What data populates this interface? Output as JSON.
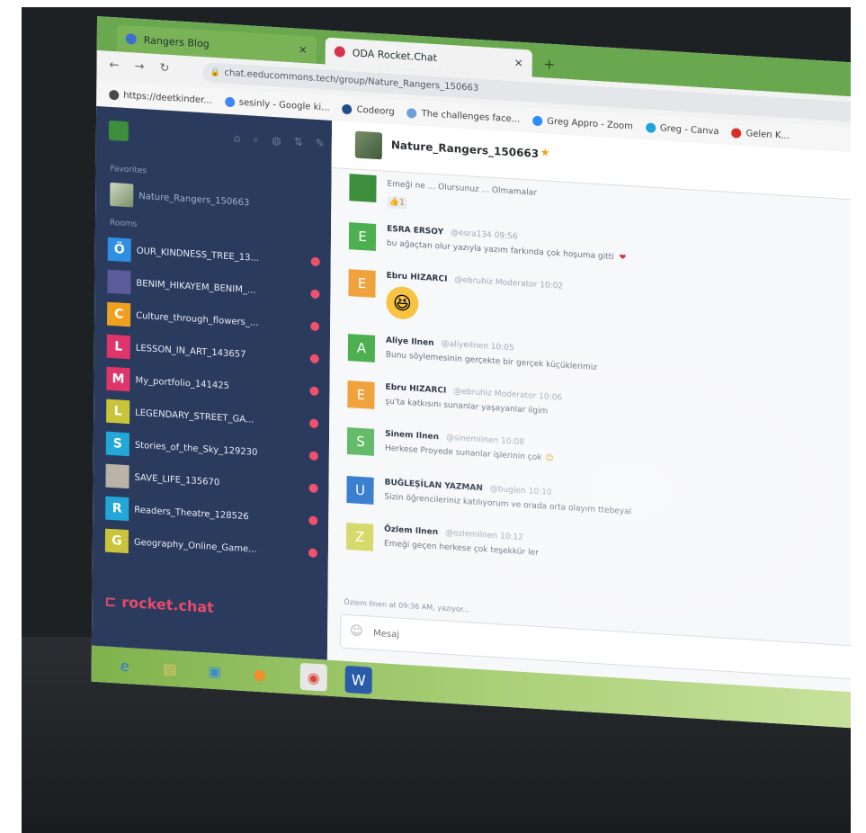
{
  "browser": {
    "tabs": [
      {
        "label": "Rangers Blog",
        "favicon_color": "#3b6fd4",
        "active": false
      },
      {
        "label": "ODA Rocket.Chat",
        "favicon_color": "#d8334a",
        "active": true
      }
    ],
    "new_tab": "+",
    "nav": {
      "back": "←",
      "forward": "→",
      "reload": "↻"
    },
    "url": "chat.eeducommons.tech/group/Nature_Rangers_150663",
    "bookmarks": [
      {
        "label": "https://deetkinder...",
        "icon_color": "#4a4a4a"
      },
      {
        "label": "sesinly - Google ki...",
        "icon_color": "#4285f4"
      },
      {
        "label": "Codeorg",
        "icon_color": "#1f4e8c"
      },
      {
        "label": "The challenges face...",
        "icon_color": "#6aa0d8"
      },
      {
        "label": "Greg Appro - Zoom",
        "icon_color": "#2d8cff"
      },
      {
        "label": "Greg - Canva",
        "icon_color": "#1fa3d9"
      },
      {
        "label": "Gelen K...",
        "icon_color": "#d93025"
      }
    ]
  },
  "sidebar": {
    "favorites_title": "Favorites",
    "favorite_room": "Nature_Rangers_150663",
    "rooms_title": "Rooms",
    "rooms": [
      {
        "initial": "Ö",
        "name": "OUR_KINDNESS_TREE_13...",
        "color": "#2f8fe0"
      },
      {
        "initial": "",
        "name": "BENIM_HIKAYEM_BENIM_...",
        "color": "#5b5b9a"
      },
      {
        "initial": "C",
        "name": "Culture_through_flowers_...",
        "color": "#f0a020"
      },
      {
        "initial": "L",
        "name": "LESSON_IN_ART_143657",
        "color": "#e0356a"
      },
      {
        "initial": "M",
        "name": "My_portfolio_141425",
        "color": "#e0356a"
      },
      {
        "initial": "L",
        "name": "LEGENDARY_STREET_GA...",
        "color": "#c9c43a"
      },
      {
        "initial": "S",
        "name": "Stories_of_the_Sky_129230",
        "color": "#22a7d8"
      },
      {
        "initial": "",
        "name": "SAVE_LIFE_135670",
        "color": "#b9b3a8"
      },
      {
        "initial": "R",
        "name": "Readers_Theatre_128526",
        "color": "#22a7d8"
      },
      {
        "initial": "G",
        "name": "Geography_Online_Game...",
        "color": "#c9c43a"
      }
    ],
    "logo": "rocket.chat"
  },
  "chat": {
    "room_title": "Nature_Rangers_150663",
    "messages": [
      {
        "initial": "",
        "name": "",
        "meta": "",
        "text": "Emeği ne ... Olursunuz ... Olmamalar",
        "color": "#3c8d3c",
        "reaction": "👍1"
      },
      {
        "initial": "E",
        "name": "ESRA ERSOY",
        "meta": "@esra134 09:56",
        "text": "bu ağaçtan olur yazıyla yazım farkında çok hoşuma gitti",
        "color": "#4caf50",
        "heart": "❤"
      },
      {
        "initial": "E",
        "name": "Ebru HIZARCI",
        "meta": "@ebruhiz Moderator 10:02",
        "text": "",
        "color": "#f0a23c",
        "emoji": "😆"
      },
      {
        "initial": "A",
        "name": "Aliye Ilnen",
        "meta": "@aliyeilnen 10:05",
        "text": "Bunu söylemesinin gerçekte bir gerçek küçüklerimiz",
        "color": "#4caf50"
      },
      {
        "initial": "E",
        "name": "Ebru HIZARCI",
        "meta": "@ebruhiz Moderator 10:06",
        "text": "şu'ta katkısını sunanlar yaşayanlar ilgim",
        "color": "#f0a23c"
      },
      {
        "initial": "S",
        "name": "Sinem Ilnen",
        "meta": "@sinemilnen 10:08",
        "text": "Herkese Proyede sunanlar işlerinin çok",
        "color": "#66bb6a",
        "smile": "😊"
      },
      {
        "initial": "U",
        "name": "BUĞLEŞİLAN YAZMAN",
        "meta": "@buglen 10:10",
        "text": "Sizin öğrencileriniz katılıyorum ve orada orta olayım ttebeyal",
        "color": "#3b7fd1"
      },
      {
        "initial": "Z",
        "name": "Özlem Ilnen",
        "meta": "@ozlemilnen 10:12",
        "text": "Emeği geçen herkese çok teşekkür ler",
        "color": "#d6d96b"
      }
    ],
    "typing": "Özlem Ilnen at 09:36 AM, yazıyor...",
    "composer_placeholder": "Mesaj",
    "composer_value": ""
  },
  "taskbar": [
    {
      "name": "ie-icon",
      "glyph": "e",
      "bg": "transparent",
      "color": "#2c7bd3"
    },
    {
      "name": "folder-icon",
      "glyph": "▤",
      "bg": "transparent",
      "color": "#e6c56a"
    },
    {
      "name": "media-icon",
      "glyph": "▣",
      "bg": "transparent",
      "color": "#3a8ad4"
    },
    {
      "name": "firefox-icon",
      "glyph": "●",
      "bg": "transparent",
      "color": "#f28c28"
    },
    {
      "name": "chrome-icon",
      "glyph": "◉",
      "bg": "#e7e7e7",
      "color": "#db4437"
    },
    {
      "name": "word-icon",
      "glyph": "W",
      "bg": "#2b5ba8",
      "color": "#ffffff"
    }
  ]
}
